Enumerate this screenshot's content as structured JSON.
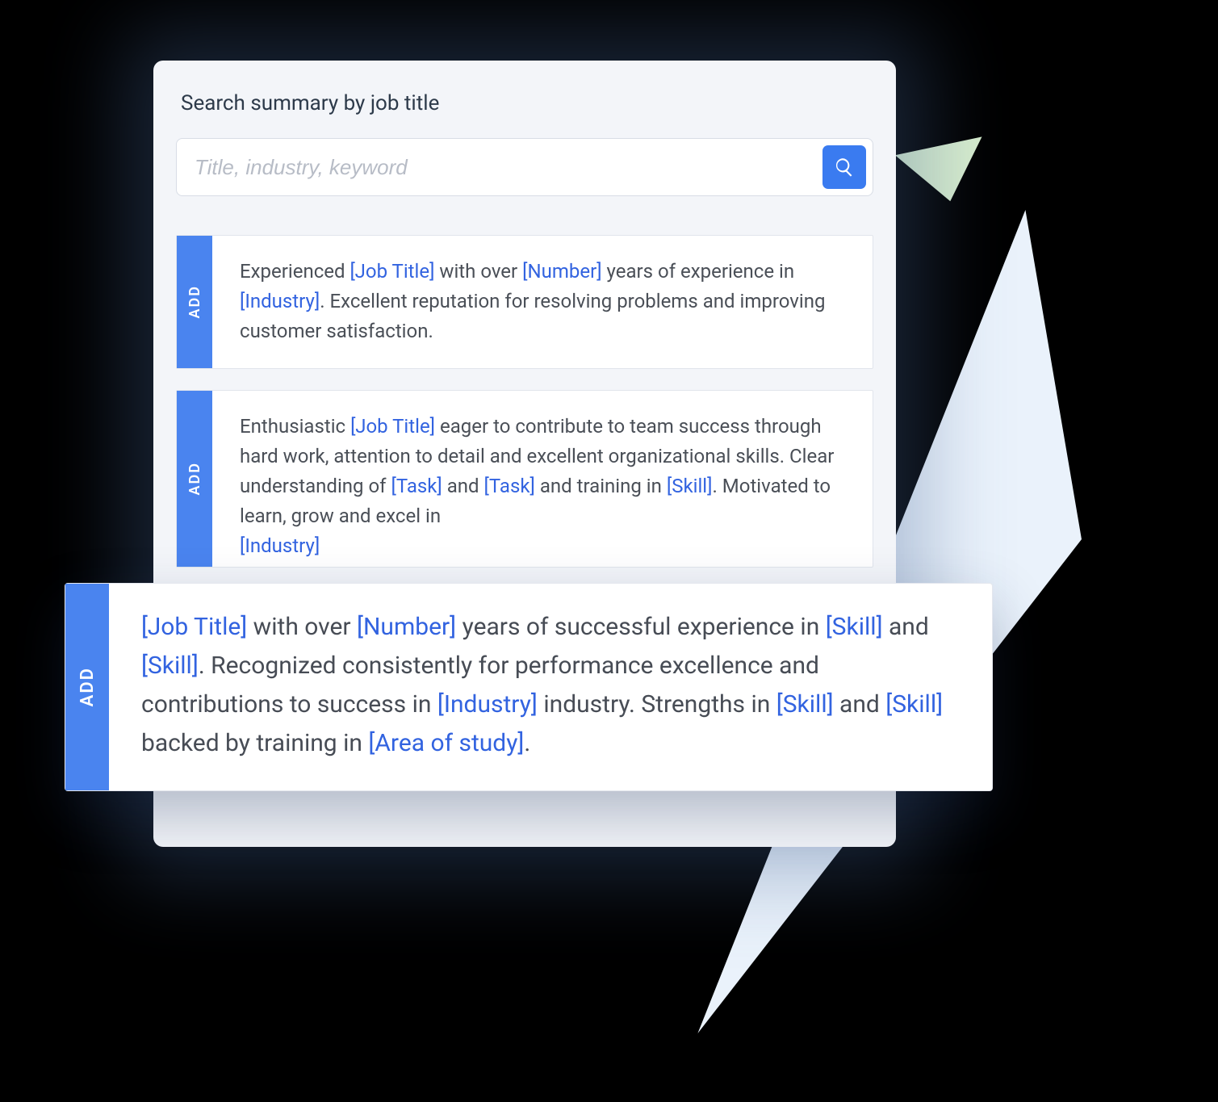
{
  "panel": {
    "title": "Search summary by job title",
    "search_placeholder": "Title, industry, keyword",
    "add_label": "ADD"
  },
  "placeholders": {
    "job_title": "[Job Title]",
    "number": "[Number]",
    "industry": "[Industry]",
    "task": "[Task]",
    "skill": "[Skill]",
    "area_of_study": "[Area of study]"
  },
  "card1": {
    "t1": "Experienced ",
    "t2": " with over ",
    "t3": " years of experience in ",
    "t4": ". Excellent reputation for resolving problems and improving customer satisfaction."
  },
  "card2": {
    "t1": "Enthusiastic ",
    "t2": " eager to contribute to team success through hard work, attention to detail and excellent organizational skills. Clear understanding of ",
    "t3": " and ",
    "t4": " and training in ",
    "t5": ". Motivated to learn, grow and excel in ",
    "t6_trunc": "[Industry]"
  },
  "card3": {
    "t1": " with over ",
    "t2": " years of successful experience in ",
    "t3": " and ",
    "t4": ". Recognized consistently for performance excellence and contributions to success in ",
    "t5": " industry. Strengths in ",
    "t6": " and ",
    "t7": " backed by training in ",
    "t8": "."
  }
}
